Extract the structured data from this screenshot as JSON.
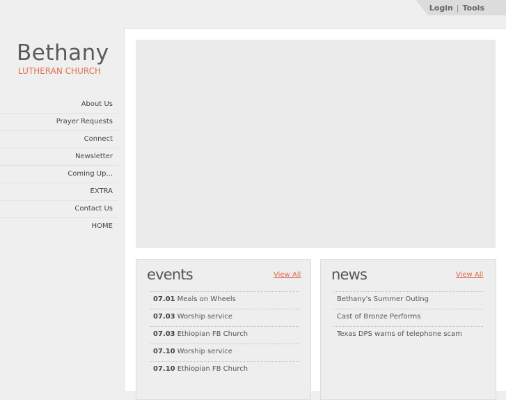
{
  "topbar": {
    "login": "Login",
    "separator": "|",
    "tools": "Tools"
  },
  "logo": {
    "name": "Bethany",
    "subtitle": "LUTHERAN CHURCH"
  },
  "sidebar": {
    "items": [
      {
        "label": "About Us"
      },
      {
        "label": "Prayer Requests"
      },
      {
        "label": "Connect"
      },
      {
        "label": "Newsletter"
      },
      {
        "label": "Coming Up..."
      },
      {
        "label": "EXTRA"
      },
      {
        "label": "Contact Us"
      },
      {
        "label": "HOME"
      }
    ]
  },
  "events": {
    "title": "events",
    "view_all": "View All",
    "items": [
      {
        "date": "07.01",
        "label": "Meals on Wheels"
      },
      {
        "date": "07.03",
        "label": "Worship service"
      },
      {
        "date": "07.03",
        "label": "Ethiopian FB Church"
      },
      {
        "date": "07.10",
        "label": "Worship service"
      },
      {
        "date": "07.10",
        "label": "Ethiopian FB Church"
      }
    ]
  },
  "news": {
    "title": "news",
    "view_all": "View All",
    "items": [
      {
        "label": "Bethany's Summer Outing"
      },
      {
        "label": "Cast of Bronze Performs"
      },
      {
        "label": "Texas DPS warns of telephone scam"
      }
    ]
  },
  "colors": {
    "accent": "#e0674a",
    "text": "#444444",
    "background": "#efefef"
  }
}
